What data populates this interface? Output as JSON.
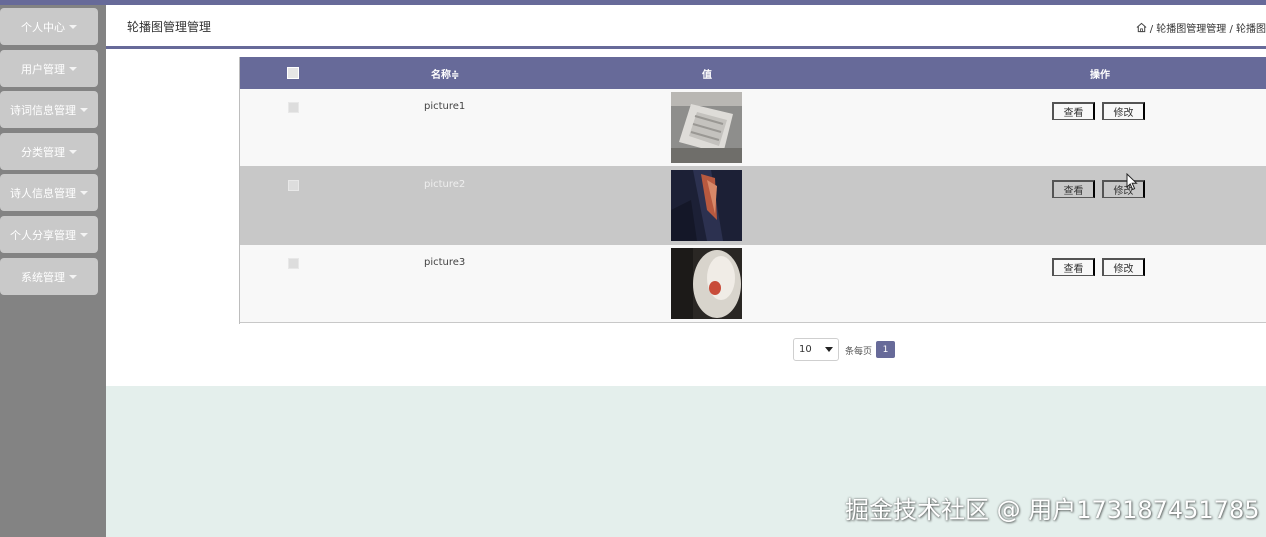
{
  "sidebar": {
    "items": [
      {
        "label": "个人中心"
      },
      {
        "label": "用户管理"
      },
      {
        "label": "诗词信息管理"
      },
      {
        "label": "分类管理"
      },
      {
        "label": "诗人信息管理"
      },
      {
        "label": "个人分享管理"
      },
      {
        "label": "系统管理"
      }
    ]
  },
  "header": {
    "title": "轮播图管理管理",
    "breadcrumb": "/ 轮播图管理管理 / 轮播图"
  },
  "table": {
    "columns": {
      "name": "名称≑",
      "value": "值",
      "actions": "操作"
    },
    "rows": [
      {
        "name": "picture1",
        "view": "查看",
        "edit": "修改"
      },
      {
        "name": "picture2",
        "view": "查看",
        "edit": "修改"
      },
      {
        "name": "picture3",
        "view": "查看",
        "edit": "修改"
      }
    ]
  },
  "pagination": {
    "page_size": "10",
    "per_page_label": "条每页",
    "current_page": "1"
  },
  "watermark": "掘金技术社区 @ 用户173187451785",
  "colors": {
    "accent": "#676a99",
    "sidebar_bg": "#838383",
    "menu_bg": "#c9c9c9",
    "selected_row": "#c8c8c8",
    "row_bg": "#f8f8f8",
    "page_bg": "#e4efec"
  }
}
